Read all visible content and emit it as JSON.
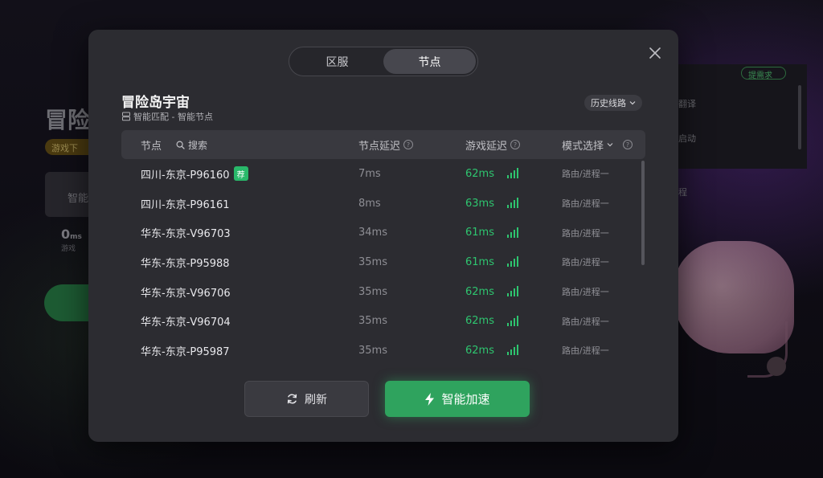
{
  "background": {
    "title": "冒险",
    "pill": "游戏下",
    "box_label": "智能",
    "zero_value": "0",
    "zero_unit": "ms",
    "zero_sub": "游戏",
    "tag": "提需求",
    "side_texts": [
      "翻译",
      "启动",
      "程"
    ]
  },
  "dialog": {
    "tabs": [
      {
        "label": "区服",
        "active": false
      },
      {
        "label": "节点",
        "active": true
      }
    ],
    "game_title": "冒险岛宇宙",
    "game_subtitle": "智能匹配 - 智能节点",
    "history_label": "历史线路",
    "table": {
      "headers": {
        "node": "节点",
        "search": "搜索",
        "node_latency": "节点延迟",
        "game_latency": "游戏延迟",
        "mode": "模式选择"
      },
      "rows": [
        {
          "name": "四川-东京-P96160",
          "badge": "荐",
          "node_latency": "7ms",
          "game_latency": "62ms",
          "mode": "路由/进程一"
        },
        {
          "name": "四川-东京-P96161",
          "badge": "",
          "node_latency": "8ms",
          "game_latency": "63ms",
          "mode": "路由/进程一"
        },
        {
          "name": "华东-东京-V96703",
          "badge": "",
          "node_latency": "34ms",
          "game_latency": "61ms",
          "mode": "路由/进程一"
        },
        {
          "name": "华东-东京-P95988",
          "badge": "",
          "node_latency": "35ms",
          "game_latency": "61ms",
          "mode": "路由/进程一"
        },
        {
          "name": "华东-东京-V96706",
          "badge": "",
          "node_latency": "35ms",
          "game_latency": "62ms",
          "mode": "路由/进程一"
        },
        {
          "name": "华东-东京-V96704",
          "badge": "",
          "node_latency": "35ms",
          "game_latency": "62ms",
          "mode": "路由/进程一"
        },
        {
          "name": "华东-东京-P95987",
          "badge": "",
          "node_latency": "35ms",
          "game_latency": "62ms",
          "mode": "路由/进程一"
        }
      ]
    },
    "refresh_label": "刷新",
    "accelerate_label": "智能加速"
  },
  "colors": {
    "accent_green": "#2fa35e",
    "latency_green": "#2ec56f",
    "modal_bg": "#2c2c31"
  },
  "icons": {
    "close": "close-icon",
    "server": "server-icon",
    "search": "search-icon",
    "help": "help-icon",
    "chevron": "chevron-down-icon",
    "signal": "signal-bars-icon",
    "refresh": "refresh-icon",
    "lightning": "lightning-icon"
  }
}
